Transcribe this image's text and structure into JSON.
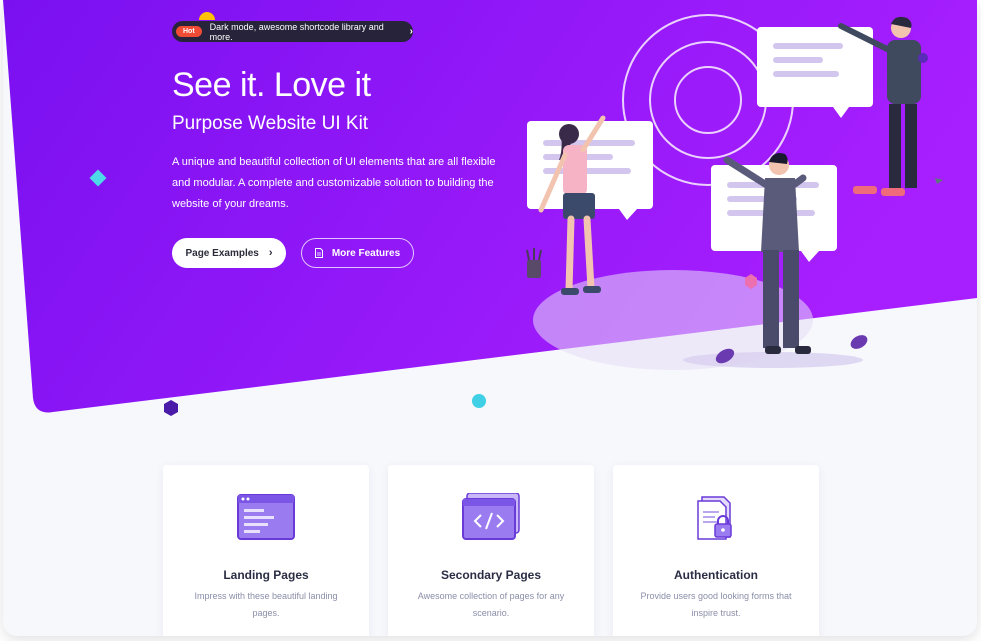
{
  "announcement": {
    "tag": "Hot",
    "text": "Dark mode, awesome shortcode library and more.",
    "arrow": "›"
  },
  "hero": {
    "title": "See it. Love it",
    "subtitle": "Purpose Website UI Kit",
    "description": "A unique and beautiful collection of UI elements that are all flexible and modular. A complete and customizable solution to building the website of your dreams.",
    "primary_button": "Page Examples",
    "secondary_button": "More Features"
  },
  "cards": [
    {
      "title": "Landing Pages",
      "description": "Impress with these beautiful landing pages.",
      "icon": "landing-page-icon"
    },
    {
      "title": "Secondary Pages",
      "description": "Awesome collection of pages for any scenario.",
      "icon": "code-window-icon"
    },
    {
      "title": "Authentication",
      "description": "Provide users good looking forms that inspire trust.",
      "icon": "lock-document-icon"
    }
  ],
  "colors": {
    "hero_start": "#7a10f0",
    "hero_end": "#a81fff",
    "accent": "#7c4dff",
    "badge_tag": "#ef4b35"
  }
}
